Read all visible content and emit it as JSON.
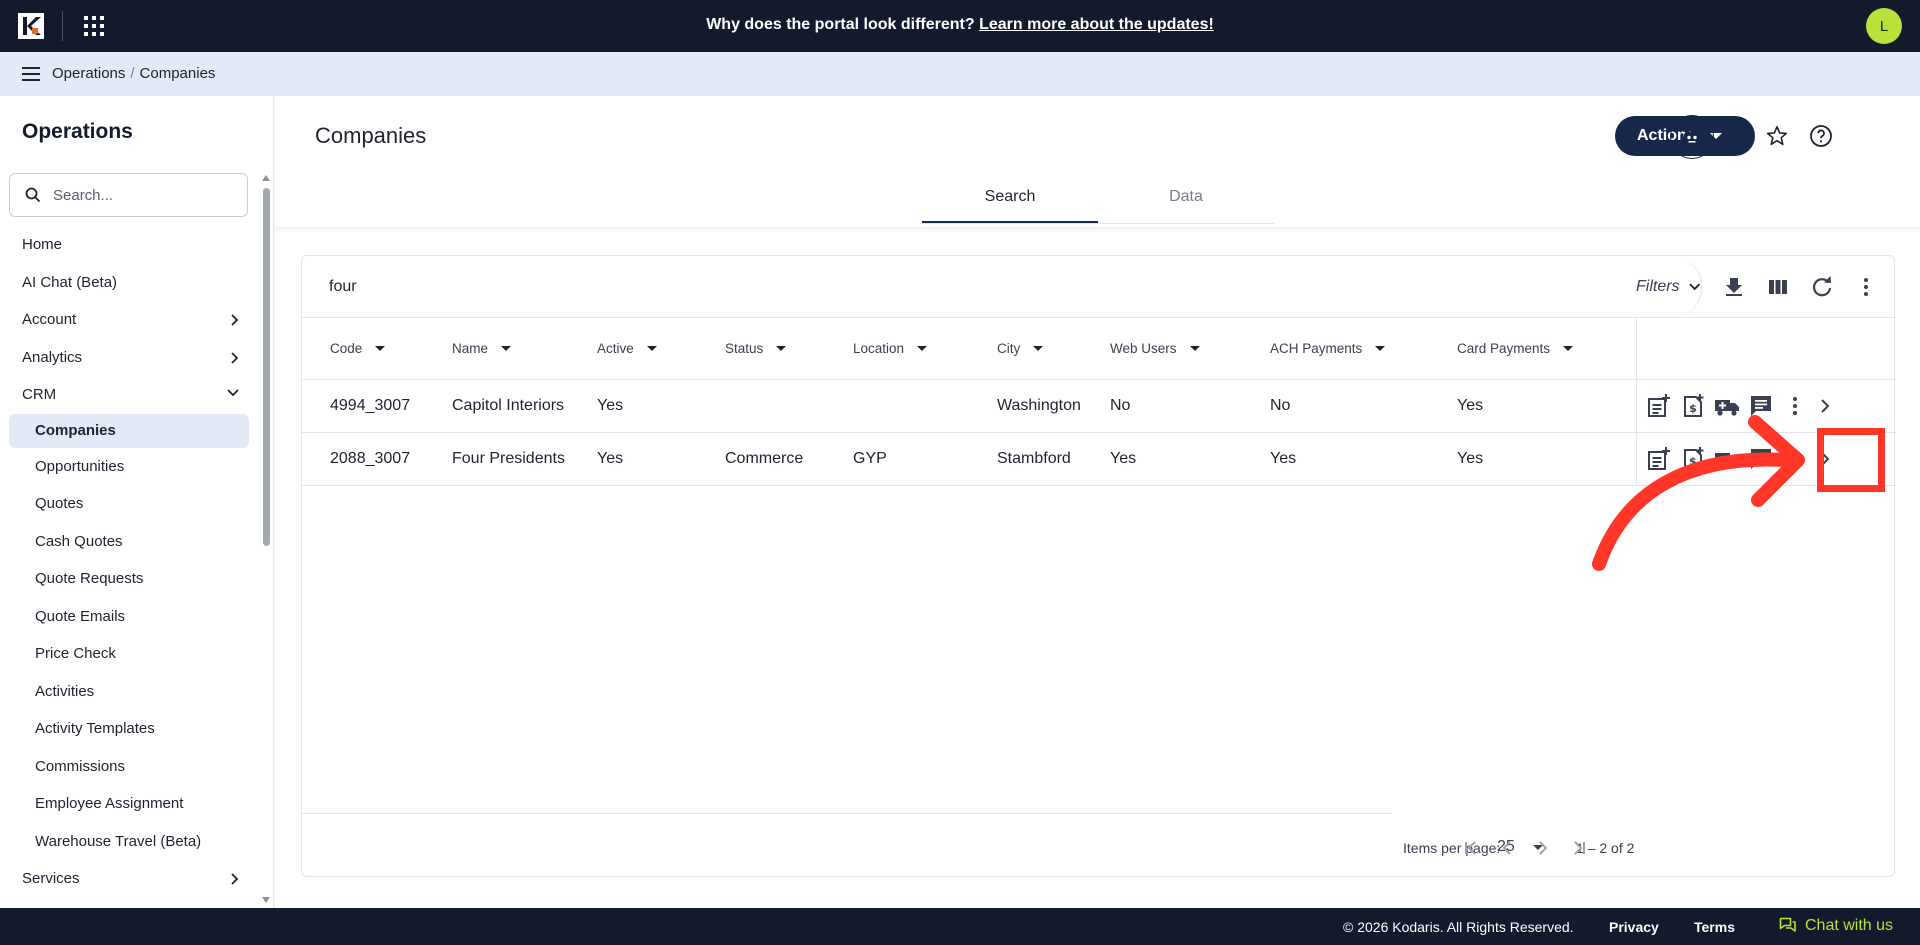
{
  "topbar": {
    "announcement": "Why does the portal look different?",
    "announcement_link": "Learn more about the updates!",
    "avatar_initial": "L"
  },
  "breadcrumb": {
    "section": "Operations",
    "page": "Companies",
    "separator": "/"
  },
  "sidebar": {
    "title": "Operations",
    "search_placeholder": "Search...",
    "items": [
      {
        "label": "Home"
      },
      {
        "label": "AI Chat (Beta)"
      },
      {
        "label": "Account"
      },
      {
        "label": "Analytics"
      },
      {
        "label": "CRM"
      },
      {
        "label": "Companies"
      },
      {
        "label": "Opportunities"
      },
      {
        "label": "Quotes"
      },
      {
        "label": "Cash Quotes"
      },
      {
        "label": "Quote Requests"
      },
      {
        "label": "Quote Emails"
      },
      {
        "label": "Price Check"
      },
      {
        "label": "Activities"
      },
      {
        "label": "Activity Templates"
      },
      {
        "label": "Commissions"
      },
      {
        "label": "Employee Assignment"
      },
      {
        "label": "Warehouse Travel (Beta)"
      },
      {
        "label": "Services"
      }
    ]
  },
  "main": {
    "title": "Companies",
    "actions_label": "Actions",
    "tabs": [
      {
        "label": "Search"
      },
      {
        "label": "Data"
      }
    ]
  },
  "grid": {
    "search_term": "four",
    "filters_label": "Filters",
    "columns": [
      "Code",
      "Name",
      "Active",
      "Status",
      "Location",
      "City",
      "Web Users",
      "ACH Payments",
      "Card Payments"
    ],
    "rows": [
      [
        "4994_3007",
        "Capitol Interiors",
        "Yes",
        "",
        "",
        "Washington",
        "No",
        "No",
        "Yes"
      ],
      [
        "2088_3007",
        "Four Presidents",
        "Yes",
        "Commerce",
        "GYP",
        "Stambford",
        "Yes",
        "Yes",
        "Yes"
      ]
    ],
    "pager": {
      "items_per_page_label": "Items per page:",
      "items_per_page": "25",
      "range": "1 – 2 of 2"
    }
  },
  "footer": {
    "copyright": "© 2026 Kodaris. All Rights Reserved.",
    "privacy": "Privacy",
    "terms": "Terms",
    "chat": "Chat with us"
  },
  "colors": {
    "navy": "#131a2e",
    "accent_button": "#16274a",
    "lime": "#b6e23a",
    "annotation_red": "#ff3628",
    "breadcrumb_bg": "#e3e9f6"
  }
}
